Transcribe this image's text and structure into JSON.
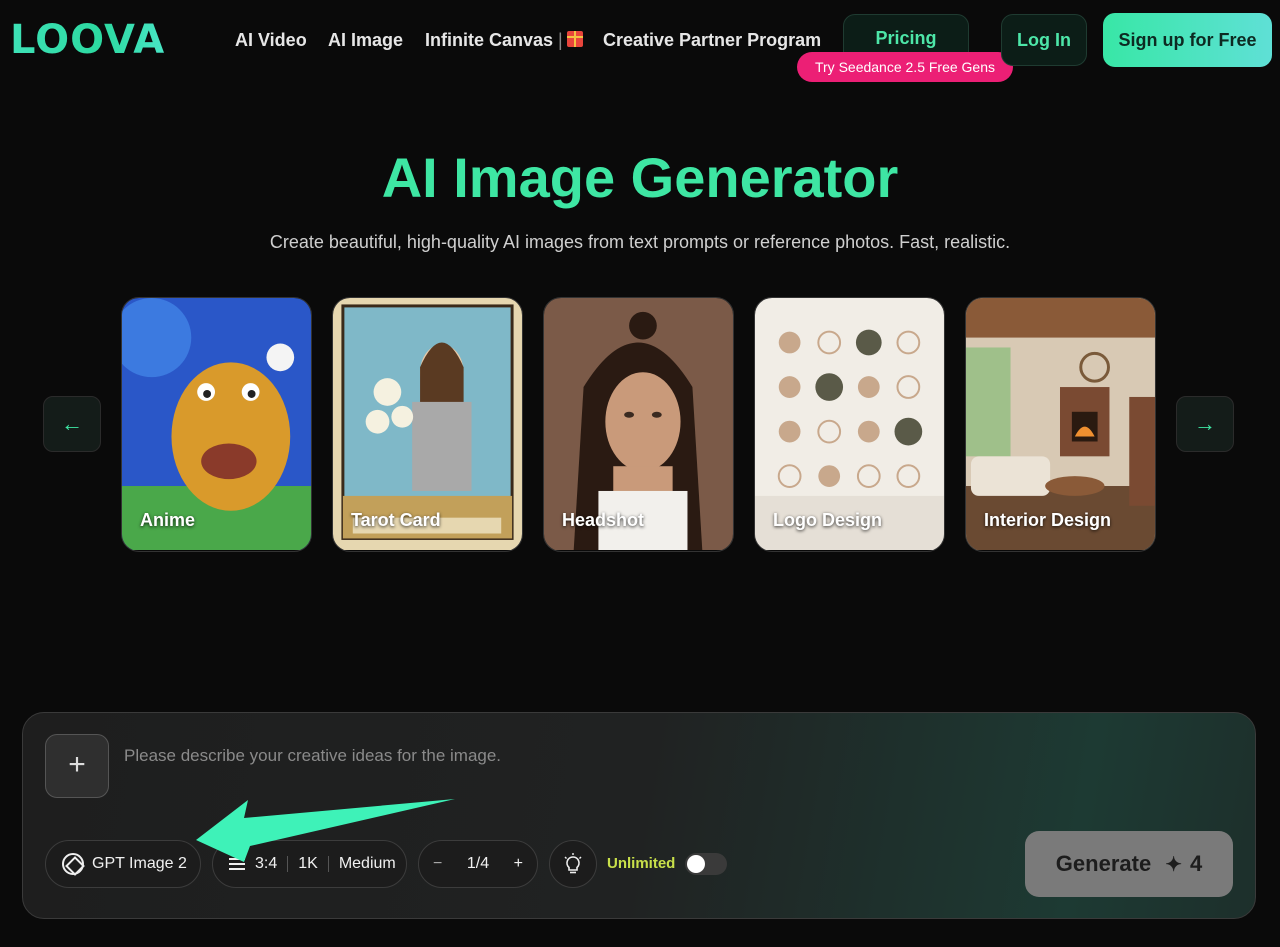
{
  "brand": {
    "logo": "LOOVA"
  },
  "nav": {
    "ai_video": "AI Video",
    "ai_image": "AI Image",
    "infinite_canvas": "Infinite Canvas",
    "separator": "|",
    "partner": "Creative Partner Program",
    "pricing": "Pricing",
    "promo_badge": "Try Seedance 2.5 Free Gens",
    "login": "Log In",
    "signup": "Sign up for Free"
  },
  "hero": {
    "title": "AI Image Generator",
    "subtitle": "Create beautiful, high-quality AI images from text prompts or reference photos. Fast, realistic."
  },
  "carousel": {
    "prev_icon": "←",
    "next_icon": "→",
    "cards": [
      {
        "label": "Anime"
      },
      {
        "label": "Tarot Card"
      },
      {
        "label": "Headshot"
      },
      {
        "label": "Logo Design"
      },
      {
        "label": "Interior Design"
      }
    ]
  },
  "composer": {
    "add_icon": "+",
    "placeholder": "Please describe your creative ideas for the image.",
    "model": "GPT Image 2",
    "aspect_ratio": "3:4",
    "resolution": "1K",
    "quality": "Medium",
    "minus": "−",
    "count": "1/4",
    "plus": "+",
    "unlimited_label": "Unlimited",
    "unlimited_enabled": false,
    "generate_label": "Generate",
    "generate_cost": "4"
  },
  "colors": {
    "accent": "#3ee6a3",
    "promo": "#ec1f75",
    "unlimited": "#c8e04a"
  }
}
